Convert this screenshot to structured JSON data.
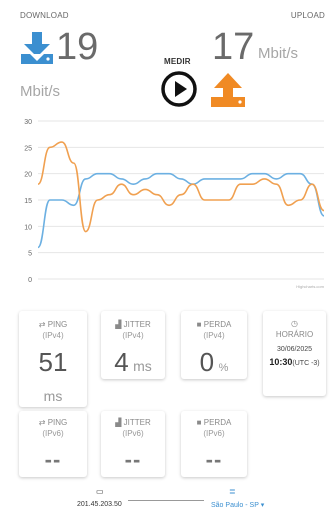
{
  "download": {
    "label": "DOWNLOAD",
    "value": "19",
    "unit": "Mbit/s"
  },
  "upload": {
    "label": "UPLOAD",
    "value": "17",
    "unit": "Mbit/s"
  },
  "start": {
    "label": "MEDIR"
  },
  "colors": {
    "download": "#3b8fd0",
    "upload": "#f08a24",
    "line_blue": "#6cb0e2",
    "line_orange": "#f0a050"
  },
  "chart_data": {
    "type": "line",
    "ylim": [
      0,
      30
    ],
    "yticks": [
      0,
      5,
      10,
      15,
      20,
      25,
      30
    ],
    "grid": true,
    "credit": "Highcharts.com",
    "series": [
      {
        "values": [
          6,
          15,
          15,
          14,
          19,
          20,
          20,
          19,
          18,
          19,
          20,
          20,
          19,
          18,
          19,
          19,
          19,
          19,
          20,
          20,
          19,
          20,
          20,
          18,
          12
        ]
      },
      {
        "values": [
          18,
          25,
          26,
          22,
          9,
          15,
          16,
          18,
          16,
          17,
          16,
          14,
          16,
          18,
          15,
          15,
          15,
          18,
          18,
          19,
          18,
          14,
          15,
          18,
          13
        ]
      }
    ]
  },
  "stats_ipv4": [
    {
      "title": "PING",
      "proto": "(IPv4)",
      "value": "51",
      "unit": "ms"
    },
    {
      "title": "JITTER",
      "proto": "(IPv4)",
      "value": "4",
      "unit": "ms"
    },
    {
      "title": "PERDA",
      "proto": "(IPv4)",
      "value": "0",
      "unit": "%"
    }
  ],
  "stats_ipv6": [
    {
      "title": "PING",
      "proto": "(IPv6)",
      "value": "--"
    },
    {
      "title": "JITTER",
      "proto": "(IPv6)",
      "value": "--"
    },
    {
      "title": "PERDA",
      "proto": "(IPv6)",
      "value": "--"
    }
  ],
  "time_card": {
    "title": "HORÁRIO",
    "date": "30/06/2025",
    "time": "10:30",
    "tz": "(UTC -3)"
  },
  "footer": {
    "ip": "201.45.203.50",
    "server": "São Paulo - SP"
  }
}
